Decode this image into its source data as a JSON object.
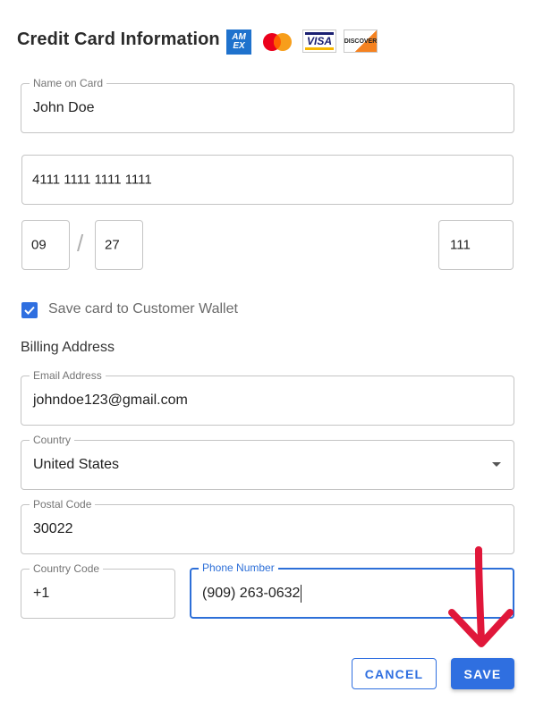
{
  "dialog": {
    "title": "Credit Card Information",
    "brands": {
      "amex_top": "AM",
      "amex_bottom": "EX",
      "visa": "VISA",
      "discover": "DISCOVER"
    }
  },
  "form": {
    "name_on_card": {
      "label": "Name on Card",
      "value": "John Doe"
    },
    "card_number": {
      "value": "4111 1111 1111 1111"
    },
    "exp_month": {
      "value": "09"
    },
    "exp_separator": "/",
    "exp_year": {
      "value": "27"
    },
    "cvv": {
      "value": "111"
    },
    "save_card": {
      "label": "Save card to Customer Wallet",
      "checked": true
    },
    "billing_heading": "Billing Address",
    "email": {
      "label": "Email Address",
      "value": "johndoe123@gmail.com"
    },
    "country": {
      "label": "Country",
      "value": "United States"
    },
    "postal_code": {
      "label": "Postal Code",
      "value": "30022"
    },
    "country_code": {
      "label": "Country Code",
      "value": "+1"
    },
    "phone_number": {
      "label": "Phone Number",
      "value": "(909) 263-0632"
    }
  },
  "actions": {
    "cancel_label": "CANCEL",
    "save_label": "SAVE"
  },
  "colors": {
    "accent": "#2f6fe0",
    "annotation_arrow": "#e0173a"
  },
  "icons": [
    "amex-logo-icon",
    "mastercard-logo-icon",
    "visa-logo-icon",
    "discover-logo-icon",
    "checkbox-checked-icon",
    "dropdown-arrow-icon",
    "red-annotation-arrow-icon"
  ]
}
